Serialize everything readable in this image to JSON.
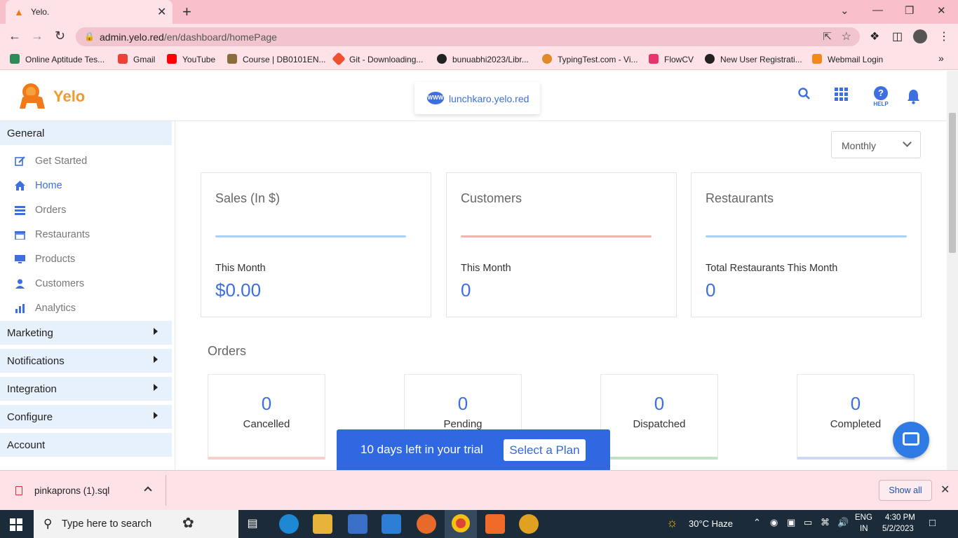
{
  "browser": {
    "tab_title": "Yelo.",
    "url_host": "admin.yelo.red",
    "url_path": "/en/dashboard/homePage",
    "bookmarks": [
      "Online Aptitude Tes...",
      "Gmail",
      "YouTube",
      "Course | DB0101EN...",
      "Git - Downloading...",
      "bunuabhi2023/Libr...",
      "TypingTest.com - Vi...",
      "FlowCV",
      "New User Registrati...",
      "Webmail Login"
    ]
  },
  "header": {
    "logo_text": "Yelo",
    "domain": "lunchkaro.yelo.red",
    "help_label": "HELP"
  },
  "sidebar": {
    "general": "General",
    "items": [
      "Get Started",
      "Home",
      "Orders",
      "Restaurants",
      "Products",
      "Customers",
      "Analytics"
    ],
    "active": "Home",
    "sections": [
      "Marketing",
      "Notifications",
      "Integration",
      "Configure",
      "Account"
    ]
  },
  "period_select": {
    "value": "Monthly"
  },
  "stats": [
    {
      "title": "Sales (In $)",
      "subtitle": "This Month",
      "value": "$0.00",
      "color": "#a9d1f7"
    },
    {
      "title": "Customers",
      "subtitle": "This Month",
      "value": "0",
      "color": "#f3b3aa"
    },
    {
      "title": "Restaurants",
      "subtitle": "Total Restaurants This Month",
      "value": "0",
      "color": "#a9d1f7"
    }
  ],
  "orders": {
    "title": "Orders",
    "cards": [
      {
        "count": "0",
        "label": "Cancelled",
        "color": "#f7cfcb"
      },
      {
        "count": "0",
        "label": "Pending",
        "color": "#f7e7b0"
      },
      {
        "count": "0",
        "label": "Dispatched",
        "color": "#bfe4c3"
      },
      {
        "count": "0",
        "label": "Completed",
        "color": "#cfd9f3"
      }
    ]
  },
  "trial_banner": {
    "text": "10 days left in your trial",
    "button": "Select a Plan"
  },
  "download_bar": {
    "file": "pinkaprons (1).sql",
    "show_all": "Show all"
  },
  "taskbar": {
    "search_placeholder": "Type here to search",
    "weather": "30°C  Haze",
    "lang_top": "ENG",
    "lang_bottom": "IN",
    "time": "4:30 PM",
    "date": "5/2/2023"
  },
  "colors": {
    "accent": "#3d6fe0",
    "brand": "#f29a2e",
    "chrome": "#f9bfcb"
  }
}
